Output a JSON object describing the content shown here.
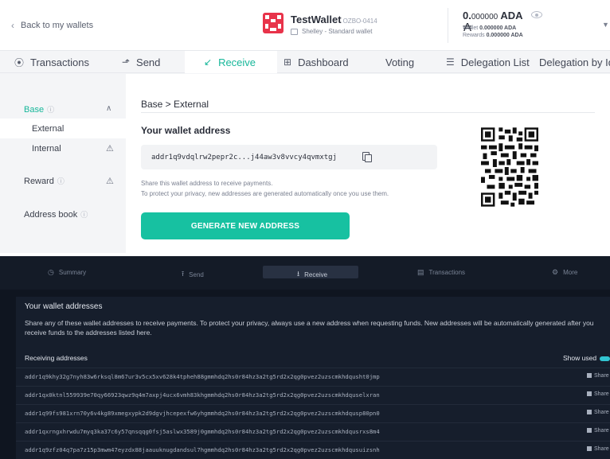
{
  "header": {
    "back_label": "Back to my wallets",
    "wallet_name": "TestWallet",
    "wallet_id": "OZBO-0414",
    "wallet_type": "Shelley - Standard wallet",
    "balance": "0.000000 ADA",
    "balance_int": "0.",
    "balance_dec": "000000",
    "balance_unit": "ADA",
    "wallet_balance_label": "Wallet",
    "wallet_balance_value": "0.000000 ADA",
    "rewards_label": "Rewards",
    "rewards_value": "0.000000 ADA"
  },
  "tabs": [
    {
      "label": "Transactions",
      "icon": "transactions-icon"
    },
    {
      "label": "Send",
      "icon": "send-icon"
    },
    {
      "label": "Receive",
      "icon": "receive-icon"
    },
    {
      "label": "Dashboard",
      "icon": "dashboard-icon"
    },
    {
      "label": "Voting",
      "icon": ""
    },
    {
      "label": "Delegation List",
      "icon": "list-icon"
    },
    {
      "label": "Delegation by Id",
      "icon": ""
    }
  ],
  "sidebar": {
    "base": "Base",
    "external": "External",
    "internal": "Internal",
    "reward": "Reward",
    "address_book": "Address book"
  },
  "receive": {
    "breadcrumb": "Base > External",
    "title": "Your wallet address",
    "address": "addr1q9vdqlrw2pepr2c...j44aw3v8vvcy4qvmxtgj",
    "hint1": "Share this wallet address to receive payments.",
    "hint2": "To protect your privacy, new addresses are generated automatically once you use them.",
    "generate_label": "GENERATE NEW ADDRESS"
  },
  "dark": {
    "tabs": [
      {
        "label": "Summary",
        "icon": "clock-icon"
      },
      {
        "label": "Send",
        "icon": "send-icon"
      },
      {
        "label": "Receive",
        "icon": "receive-icon"
      },
      {
        "label": "Transactions",
        "icon": "transactions-icon"
      },
      {
        "label": "More",
        "icon": "gear-icon"
      }
    ],
    "title": "Your wallet addresses",
    "description": "Share any of these wallet addresses to receive payments. To protect your privacy, always use a new address when requesting funds. New addresses will be automatically generated after you receive funds to the addresses listed here.",
    "receiving_label": "Receiving addresses",
    "show_used_label": "Show used",
    "share_label": "Share",
    "addresses": [
      "addr1q9khy32g7nyh83w6rksql8m67ur3v5cx5xv628k4tpheh88gmmhdq2hs0r84hz3a2tg5rd2x2qg0pvez2uzscmkhdqusht0jmp",
      "addr1qx0ktnl559939e70qy66923qwz9q4m7axpj4ucx6vmh83khgmmhdq2hs0r84hz3a2tg5rd2x2qg0pvez2uzscmkhdquselxran",
      "addr1q99fs981xrn70y6v4kg89xmegxypk2d9dgvjhcepexfw6yhgmmhdq2hs0r84hz3a2tg5rd2x2qg0pvez2uzscmkhdqusp80pn0",
      "addr1qxrngxhrwdu7myq3ka37c6y57qnsqqg0fsj5aslwx3589j0gmmhdq2hs0r84hz3a2tg5rd2x2qg0pvez2uzscmkhdqusrxs8m4",
      "addr1q9zfz04q7pa7z15p3mwm47eyzdx88jaauuknugdandsul7hgmmhdq2hs0r84hz3a2tg5rd2x2qg0pvez2uzscmkhdqusuizsnh"
    ]
  },
  "colors": {
    "accent": "#17c1a1",
    "dark_bg": "#0f1520",
    "toggle": "#32c5d2"
  }
}
